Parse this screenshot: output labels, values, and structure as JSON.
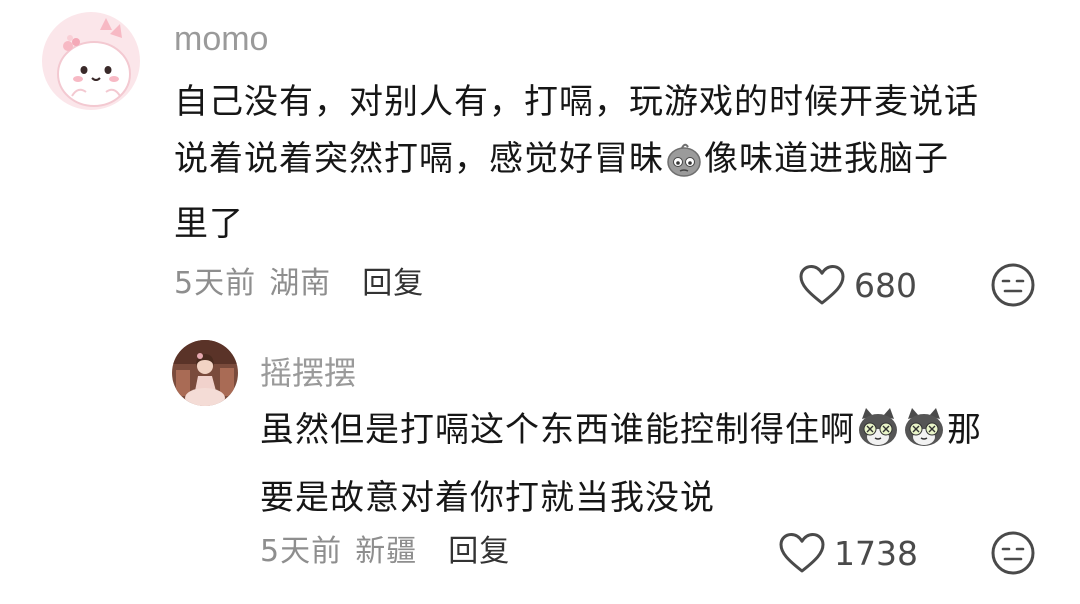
{
  "comments": [
    {
      "username": "momo",
      "text_parts": [
        "自己没有，对别人有，打嗝，玩游戏的时候开麦说话",
        "说着说着突然打嗝，感觉好冒昧",
        "像味道进我脑子",
        "里了"
      ],
      "emoji": [
        "embarrassed-gray-face-emoji"
      ],
      "time": "5天前",
      "location": "湖南",
      "reply_label": "回复",
      "likes": "680"
    },
    {
      "username": "摇摆摆",
      "text_parts": [
        "虽然但是打嗝这个东西谁能控制得住啊",
        "那",
        "要是故意对着你打就当我没说"
      ],
      "emoji": [
        "dizzy-cat-emoji",
        "dizzy-cat-emoji"
      ],
      "time": "5天前",
      "location": "新疆",
      "reply_label": "回复",
      "likes": "1738"
    }
  ],
  "icons": {
    "like": "heart-outline-icon",
    "dislike": "neutral-face-icon"
  },
  "colors": {
    "username": "#9a9a9a",
    "text": "#161616",
    "meta": "#8e8e8e"
  }
}
